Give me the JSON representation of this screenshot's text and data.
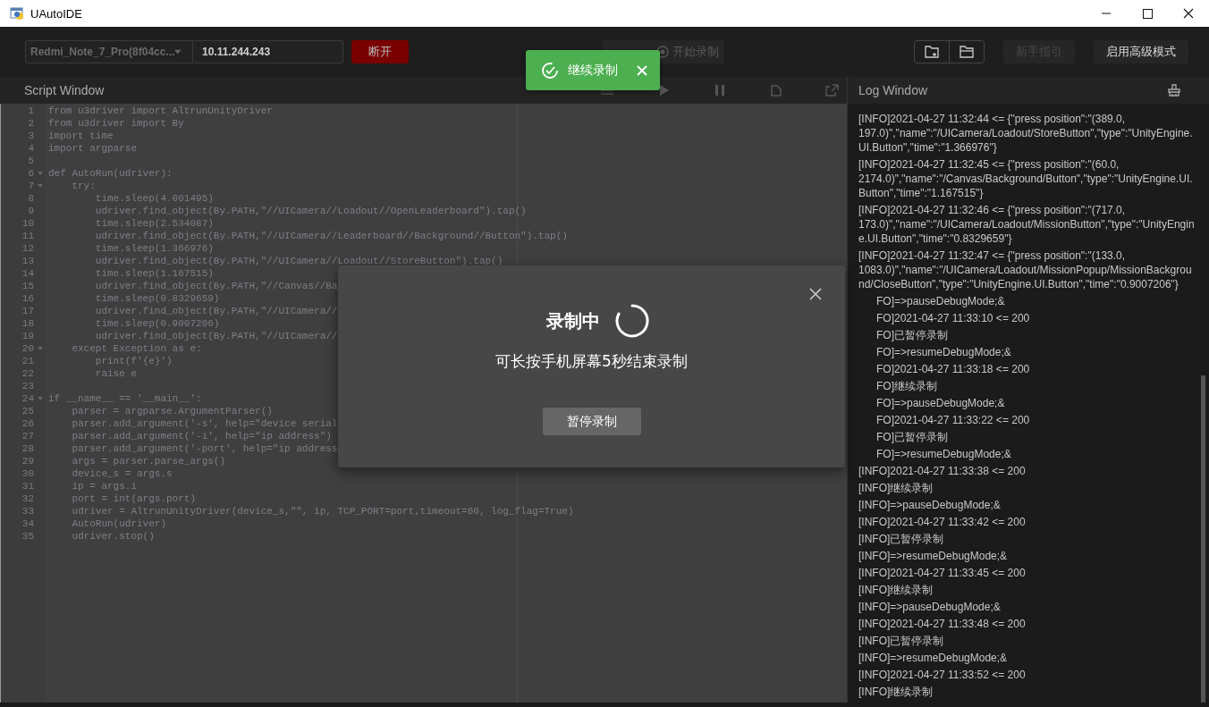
{
  "window": {
    "title": "UAutoIDE"
  },
  "toolbar": {
    "device_select": {
      "value": "Redmi_Note_7_Pro(8f04cc..."
    },
    "ip_field": {
      "value": "10.11.244.243"
    },
    "disconnect_button": "断开",
    "record_button": {
      "label": "开始录制",
      "disabled": true
    },
    "guide_button": {
      "label": "新手指引",
      "disabled": true
    },
    "advanced_button": {
      "label": "启用高级模式",
      "disabled": false
    }
  },
  "toast": {
    "message": "继续录制"
  },
  "script_window": {
    "title": "Script Window",
    "lines": [
      {
        "number": "1",
        "text": "from u3driver import AltrunUnityDriver",
        "foldable": false
      },
      {
        "number": "2",
        "text": "from u3driver import By",
        "foldable": false
      },
      {
        "number": "3",
        "text": "import time",
        "foldable": false
      },
      {
        "number": "4",
        "text": "import argparse",
        "foldable": false
      },
      {
        "number": "5",
        "foldable": false
      },
      {
        "number": "6",
        "text": "def AutoRun(udriver):",
        "foldable": true
      },
      {
        "number": "7",
        "text": "    try:",
        "foldable": true
      },
      {
        "number": "8",
        "text": "        time.sleep(4.001495)",
        "foldable": false
      },
      {
        "number": "9",
        "text": "        udriver.find_object(By.PATH,\"//UICamera//Loadout//OpenLeaderboard\").tap()",
        "foldable": false
      },
      {
        "number": "10",
        "text": "        time.sleep(2.534087)",
        "foldable": false
      },
      {
        "number": "11",
        "text": "        udriver.find_object(By.PATH,\"//UICamera//Leaderboard//Background//Button\").tap()",
        "foldable": false
      },
      {
        "number": "12",
        "text": "        time.sleep(1.366976)",
        "foldable": false
      },
      {
        "number": "13",
        "text": "        udriver.find_object(By.PATH,\"//UICamera//Loadout//StoreButton\").tap()",
        "foldable": false
      },
      {
        "number": "14",
        "text": "        time.sleep(1.167515)",
        "foldable": false
      },
      {
        "number": "15",
        "text": "        udriver.find_object(By.PATH,\"//Canvas//Ba",
        "foldable": false
      },
      {
        "number": "16",
        "text": "        time.sleep(0.8329659)",
        "foldable": false
      },
      {
        "number": "17",
        "text": "        udriver.find_object(By.PATH,\"//UICamera//",
        "foldable": false
      },
      {
        "number": "18",
        "text": "        time.sleep(0.9007206)",
        "foldable": false
      },
      {
        "number": "19",
        "text": "        udriver.find_object(By.PATH,\"//UICamera//",
        "foldable": false
      },
      {
        "number": "20",
        "text": "    except Exception as e:",
        "foldable": true
      },
      {
        "number": "21",
        "text": "        print(f'{e}')",
        "foldable": false
      },
      {
        "number": "22",
        "text": "        raise e",
        "foldable": false
      },
      {
        "number": "23",
        "foldable": false
      },
      {
        "number": "24",
        "text": "if __name__ == '__main__':",
        "foldable": true
      },
      {
        "number": "25",
        "text": "    parser = argparse.ArgumentParser()",
        "foldable": false
      },
      {
        "number": "26",
        "text": "    parser.add_argument('-s', help=\"device serial",
        "foldable": false
      },
      {
        "number": "27",
        "text": "    parser.add_argument('-i', help=\"ip address\")",
        "foldable": false
      },
      {
        "number": "28",
        "text": "    parser.add_argument('-port', help=\"ip address",
        "foldable": false
      },
      {
        "number": "29",
        "text": "    args = parser.parse_args()",
        "foldable": false
      },
      {
        "number": "30",
        "text": "    device_s = args.s",
        "foldable": false
      },
      {
        "number": "31",
        "text": "    ip = args.i",
        "foldable": false
      },
      {
        "number": "32",
        "text": "    port = int(args.port)",
        "foldable": false
      },
      {
        "number": "33",
        "text": "    udriver = AltrunUnityDriver(device_s,\"\", ip, TCP_PORT=port,timeout=60, log_flag=True)",
        "foldable": false
      },
      {
        "number": "34",
        "text": "    AutoRun(udriver)",
        "foldable": false
      },
      {
        "number": "35",
        "text": "    udriver.stop()",
        "foldable": false
      }
    ]
  },
  "log_window": {
    "title": "Log Window",
    "entries": [
      {
        "kind": "full",
        "text": "[INFO]2021-04-27 11:32:44 <= {\"press position\":\"(389.0, 197.0)\",\"name\":\"/UICamera/Loadout/StoreButton\",\"type\":\"UnityEngine.UI.Button\",\"time\":\"1.366976\"}"
      },
      {
        "kind": "full",
        "text": "[INFO]2021-04-27 11:32:45 <= {\"press position\":\"(60.0, 2174.0)\",\"name\":\"/Canvas/Background/Button\",\"type\":\"UnityEngine.UI.Button\",\"time\":\"1.167515\"}"
      },
      {
        "kind": "full",
        "text": "[INFO]2021-04-27 11:32:46 <= {\"press position\":\"(717.0, 173.0)\",\"name\":\"/UICamera/Loadout/MissionButton\",\"type\":\"UnityEngine.UI.Button\",\"time\":\"0.8329659\"}"
      },
      {
        "kind": "full",
        "text": "[INFO]2021-04-27 11:32:47 <= {\"press position\":\"(133.0, 1083.0)\",\"name\":\"/UICamera/Loadout/MissionPopup/MissionBackground/CloseButton\",\"type\":\"UnityEngine.UI.Button\",\"time\":\"0.9007206\"}"
      },
      {
        "kind": "partial",
        "text": "FO]=>pauseDebugMode;&"
      },
      {
        "kind": "partial",
        "text": "FO]2021-04-27 11:33:10 <= 200"
      },
      {
        "kind": "partial",
        "text": "FO]已暂停录制"
      },
      {
        "kind": "partial",
        "text": "FO]=>resumeDebugMode;&"
      },
      {
        "kind": "partial",
        "text": "FO]2021-04-27 11:33:18 <= 200"
      },
      {
        "kind": "partial",
        "text": "FO]继续录制"
      },
      {
        "kind": "partial",
        "text": "FO]=>pauseDebugMode;&"
      },
      {
        "kind": "partial",
        "text": "FO]2021-04-27 11:33:22 <= 200"
      },
      {
        "kind": "partial",
        "text": "FO]已暂停录制"
      },
      {
        "kind": "partial",
        "text": "FO]=>resumeDebugMode;&"
      },
      {
        "kind": "full",
        "text": "[INFO]2021-04-27 11:33:38 <= 200"
      },
      {
        "kind": "full",
        "text": "[INFO]继续录制"
      },
      {
        "kind": "full",
        "text": "[INFO]=>pauseDebugMode;&"
      },
      {
        "kind": "full",
        "text": "[INFO]2021-04-27 11:33:42 <= 200"
      },
      {
        "kind": "full",
        "text": "[INFO]已暂停录制"
      },
      {
        "kind": "full",
        "text": "[INFO]=>resumeDebugMode;&"
      },
      {
        "kind": "full",
        "text": "[INFO]2021-04-27 11:33:45 <= 200"
      },
      {
        "kind": "full",
        "text": "[INFO]继续录制"
      },
      {
        "kind": "full",
        "text": "[INFO]=>pauseDebugMode;&"
      },
      {
        "kind": "full",
        "text": "[INFO]2021-04-27 11:33:48 <= 200"
      },
      {
        "kind": "full",
        "text": "[INFO]已暂停录制"
      },
      {
        "kind": "full",
        "text": "[INFO]=>resumeDebugMode;&"
      },
      {
        "kind": "full",
        "text": "[INFO]2021-04-27 11:33:52 <= 200"
      },
      {
        "kind": "full",
        "text": "[INFO]继续录制"
      }
    ]
  },
  "dialog": {
    "title": "录制中",
    "message": "可长按手机屏幕5秒结束录制",
    "button": "暂停录制"
  }
}
